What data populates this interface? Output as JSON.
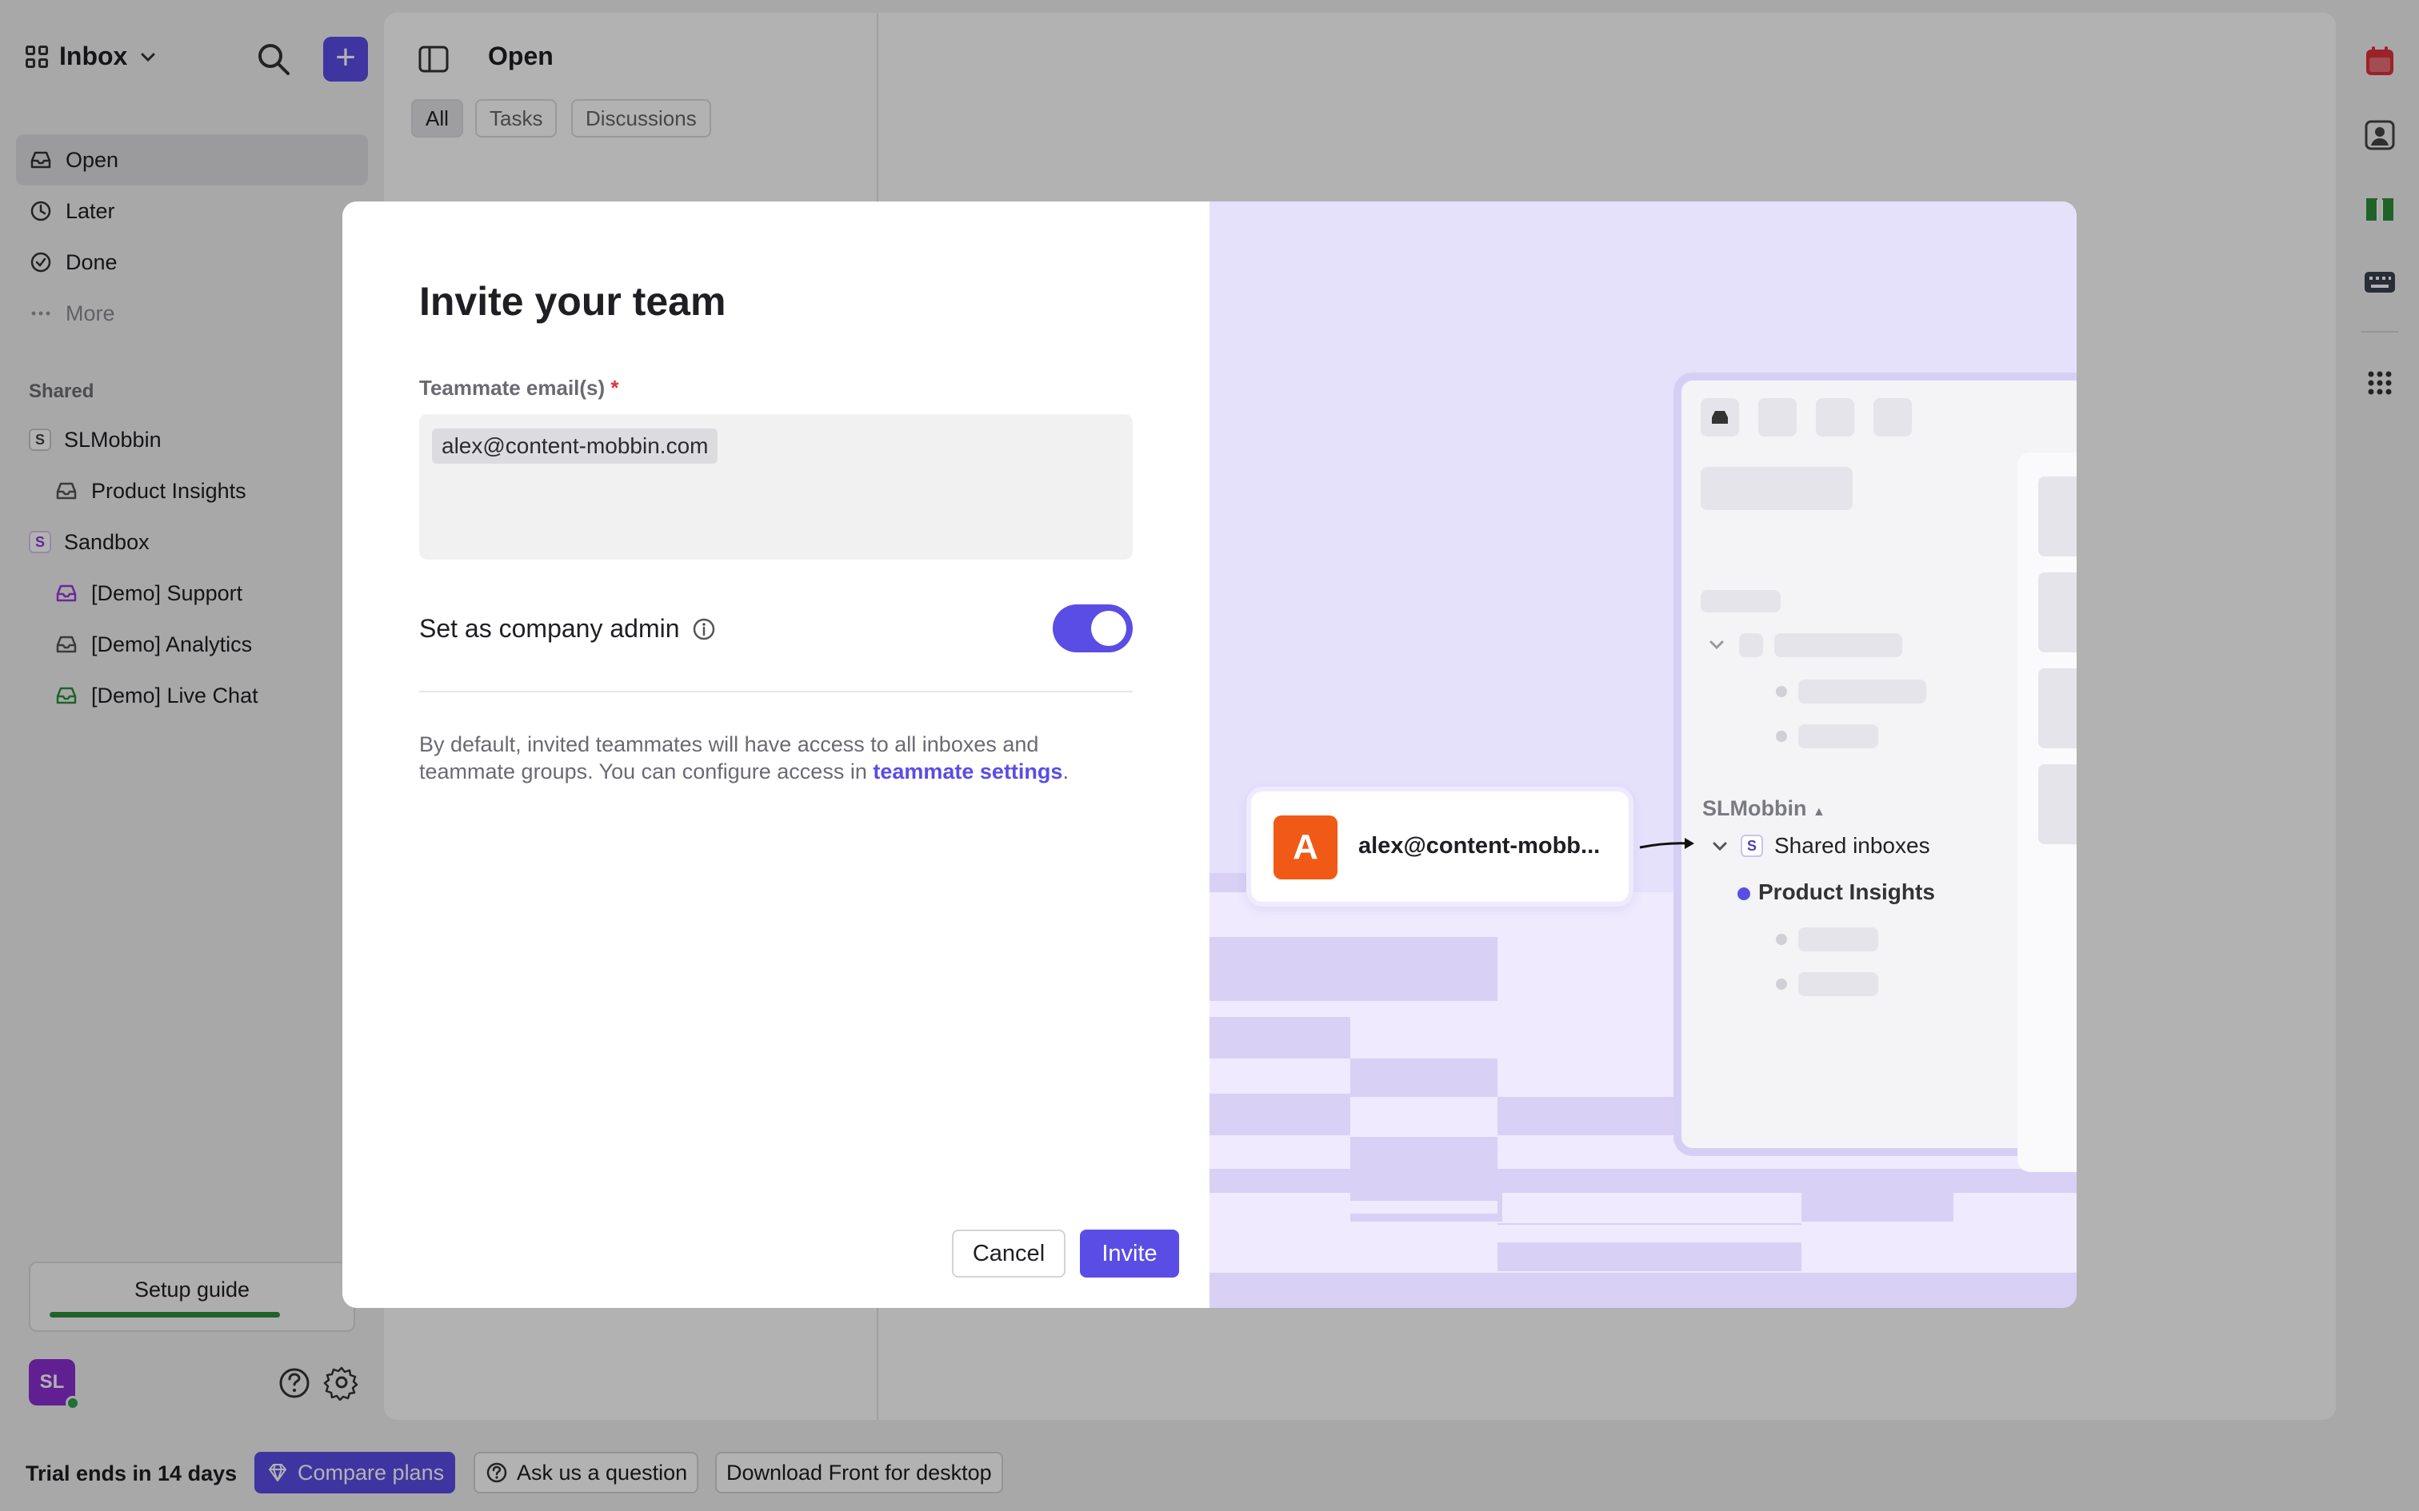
{
  "sidebar": {
    "workspace_label": "Inbox",
    "nav": [
      {
        "label": "Open"
      },
      {
        "label": "Later"
      },
      {
        "label": "Done"
      },
      {
        "label": "More"
      }
    ],
    "shared_label": "Shared",
    "items": [
      {
        "label": "SLMobbin",
        "badge": "S"
      },
      {
        "label": "Product Insights"
      },
      {
        "label": "Sandbox",
        "badge": "S"
      },
      {
        "label": "[Demo] Support"
      },
      {
        "label": "[Demo] Analytics"
      },
      {
        "label": "[Demo] Live Chat"
      }
    ],
    "setup_guide": "Setup guide",
    "setup_progress": 0.8,
    "avatar_initials": "SL"
  },
  "main": {
    "title": "Open",
    "filters": [
      "All",
      "Tasks",
      "Discussions"
    ]
  },
  "bottom": {
    "trial": "Trial ends in 14 days",
    "compare": "Compare plans",
    "ask": "Ask us a question",
    "download": "Download Front for desktop"
  },
  "modal": {
    "title": "Invite your team",
    "field_label": "Teammate email(s)",
    "required_mark": "*",
    "email_chip": "alex@content-mobbin.com",
    "admin_label": "Set as company admin",
    "admin_enabled": true,
    "note_text": "By default, invited teammates will have access to all inboxes and teammate groups. You can configure access in ",
    "note_link": "teammate settings",
    "note_end": ".",
    "cancel": "Cancel",
    "invite": "Invite",
    "illustration": {
      "avatar_letter": "A",
      "email": "alex@content-mobb...",
      "org": "SLMobbin",
      "badge": "S",
      "shared_inboxes": "Shared inboxes",
      "product_insights": "Product Insights"
    }
  },
  "colors": {
    "accent": "#5a4de6",
    "illustration_bg": "#e6e1fb",
    "avatar_orange": "#f05a16",
    "avatar_purple": "#8a2fd0"
  }
}
